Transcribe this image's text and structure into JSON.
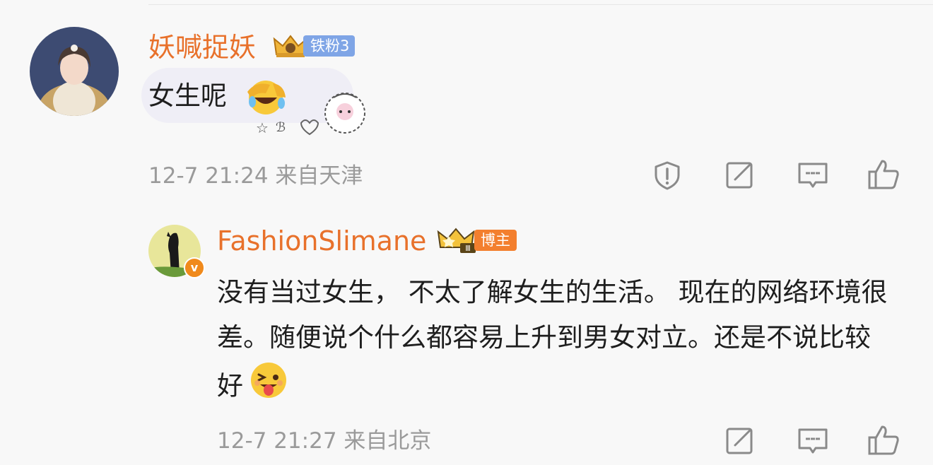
{
  "comment1": {
    "username": "妖喊捉妖",
    "fan_badge": "铁粉3",
    "text": "女生呢",
    "emoji": "laugh-cry-emoji",
    "time": "12-7 21:24",
    "location": "来自天津"
  },
  "comment2": {
    "username": "FashionSlimane",
    "role_badge": "博主",
    "crown_level": "Ⅲ",
    "verified": "v",
    "text": "没有当过女生， 不太了解女生的生活。 现在的网络环境很差。随便说个什么都容易上升到男女对立。还是不说比较好",
    "emoji": "wink-tongue-emoji",
    "time": "12-7 21:27",
    "location": "来自北京"
  },
  "colors": {
    "username": "#e8712b",
    "meta": "#9a9a9a",
    "fan_badge": "#7fa5e6",
    "role_badge": "#f37f2e"
  }
}
